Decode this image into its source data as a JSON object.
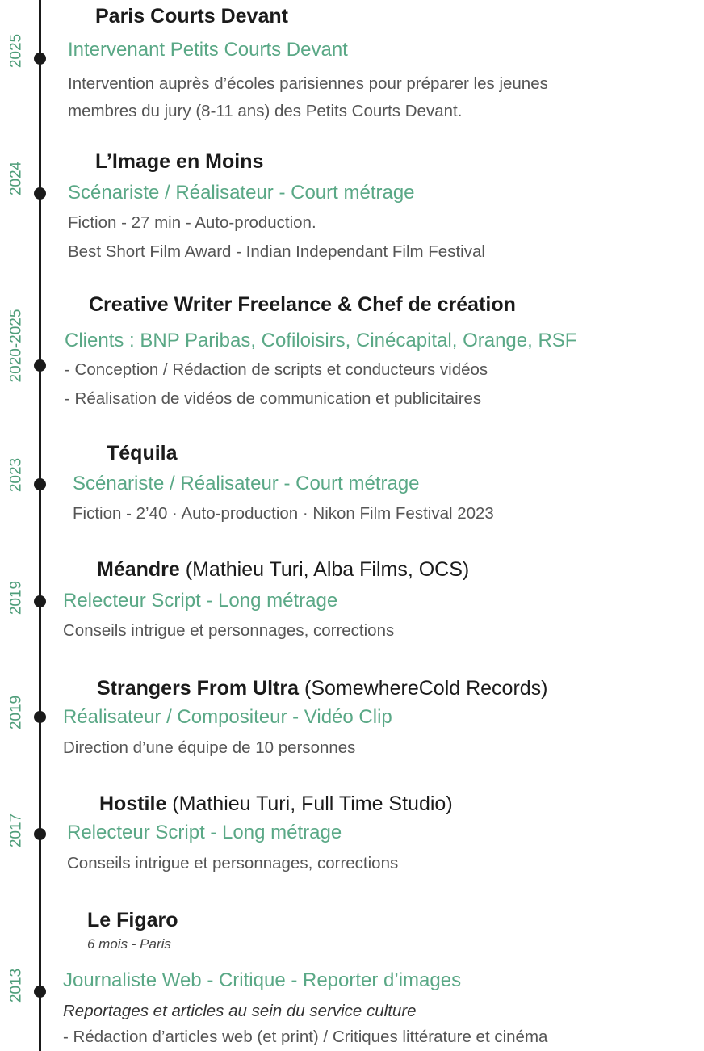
{
  "entries": [
    {
      "year": "2025",
      "title": "Paris Courts Devant",
      "title_extra": "",
      "role": "Intervenant Petits Courts Devant",
      "lines": [
        "Intervention auprès d’écoles parisiennes pour préparer les jeunes",
        "membres du jury (8-11 ans) des Petits Courts Devant."
      ]
    },
    {
      "year": "2024",
      "title": "L’Image en Moins",
      "title_extra": "",
      "role": "Scénariste / Réalisateur - Court métrage",
      "lines": [
        "Fiction - 27 min - Auto-production.",
        "Best Short Film Award - Indian Independant Film Festival"
      ]
    },
    {
      "year": "2020-2025",
      "title": "Creative Writer Freelance & Chef de création",
      "title_extra": "",
      "role": "Clients : BNP Paribas, Cofiloisirs, Cinécapital, Orange, RSF",
      "lines": [
        "- Conception / Rédaction de scripts et conducteurs vidéos",
        "- Réalisation de vidéos de communication et publicitaires"
      ]
    },
    {
      "year": "2023",
      "title": "Téquila",
      "title_extra": "",
      "role": "Scénariste / Réalisateur - Court métrage",
      "lines": [
        "Fiction - 2’40 · Auto-production · Nikon Film Festival 2023"
      ]
    },
    {
      "year": "2019",
      "title": "Méandre",
      "title_extra": " (Mathieu Turi, Alba Films, OCS)",
      "role": "Relecteur Script - Long métrage",
      "lines": [
        "Conseils intrigue et personnages, corrections"
      ]
    },
    {
      "year": "2019",
      "title": "Strangers From Ultra",
      "title_extra": " (SomewhereCold Records)",
      "role": "Réalisateur / Compositeur  - Vidéo Clip",
      "lines": [
        "Direction d’une équipe de 10 personnes"
      ]
    },
    {
      "year": "2017",
      "title": "Hostile",
      "title_extra": " (Mathieu Turi, Full Time Studio)",
      "role": "Relecteur Script - Long métrage",
      "lines": [
        "Conseils intrigue et personnages, corrections"
      ]
    },
    {
      "year": "2013",
      "title": "Le Figaro",
      "title_extra": "",
      "meta": "6 mois - Paris",
      "role": "Journaliste Web - Critique - Reporter d’images",
      "lines": [
        "Reportages et articles au sein du service culture",
        "- Rédaction d’articles web (et print) / Critiques littérature et cinéma"
      ]
    }
  ]
}
